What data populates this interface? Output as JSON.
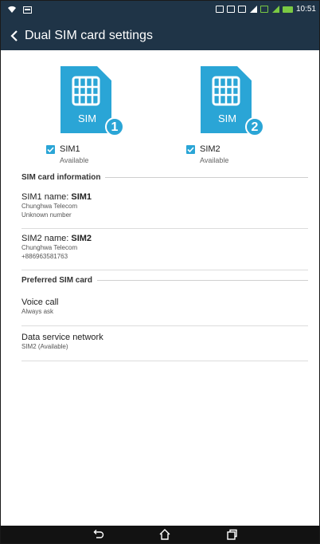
{
  "status_bar": {
    "time": "10:51"
  },
  "action_bar": {
    "title": "Dual SIM card settings"
  },
  "sims": [
    {
      "card_text": "SIM",
      "number": "1",
      "label": "SIM1",
      "status": "Available",
      "checked": true
    },
    {
      "card_text": "SIM",
      "number": "2",
      "label": "SIM2",
      "status": "Available",
      "checked": true
    }
  ],
  "sim_info": {
    "header": "SIM card information",
    "sim1": {
      "name_label": "SIM1 name: ",
      "name_value": "SIM1",
      "carrier": "Chunghwa Telecom",
      "number": "Unknown number"
    },
    "sim2": {
      "name_label": "SIM2 name: ",
      "name_value": "SIM2",
      "carrier": "Chunghwa Telecom",
      "number": "+886963581763"
    }
  },
  "preferred": {
    "header": "Preferred SIM card",
    "voice": {
      "title": "Voice call",
      "value": "Always ask"
    },
    "data": {
      "title": "Data service network",
      "value": "SIM2 (Available)"
    }
  },
  "colors": {
    "bar": "#1f3447",
    "accent": "#2aa5d6",
    "signal_green": "#7ac943"
  },
  "icons": [
    "wifi-icon",
    "message-icon",
    "vibrate-icon",
    "sim-icon",
    "signal-icon",
    "battery-icon",
    "back-icon",
    "home-icon",
    "recents-icon"
  ]
}
